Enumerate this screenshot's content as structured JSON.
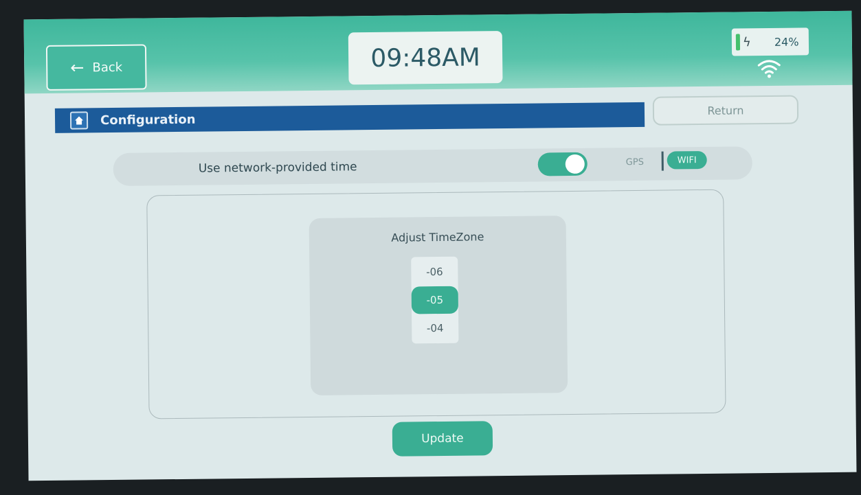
{
  "topbar": {
    "back_label": "Back",
    "clock": "09:48AM",
    "battery_percent": "24%",
    "battery_level": 0.24,
    "battery_icon": "battery-charging-icon",
    "wifi_icon": "wifi-icon"
  },
  "header": {
    "title": "Configuration",
    "home_icon": "home-icon",
    "return_label": "Return"
  },
  "network": {
    "label": "Use network-provided time",
    "toggle_on": true,
    "gps_label": "GPS",
    "wifi_label": "WIFI",
    "selected_source": "WIFI"
  },
  "timezone": {
    "title": "Adjust TimeZone",
    "options": [
      "-06",
      "-05",
      "-04"
    ],
    "selected": "-05"
  },
  "footer": {
    "update_label": "Update"
  },
  "colors": {
    "accent": "#3aae93",
    "header_blue": "#1c5b9a",
    "topbar_green": "#3fb79c"
  }
}
